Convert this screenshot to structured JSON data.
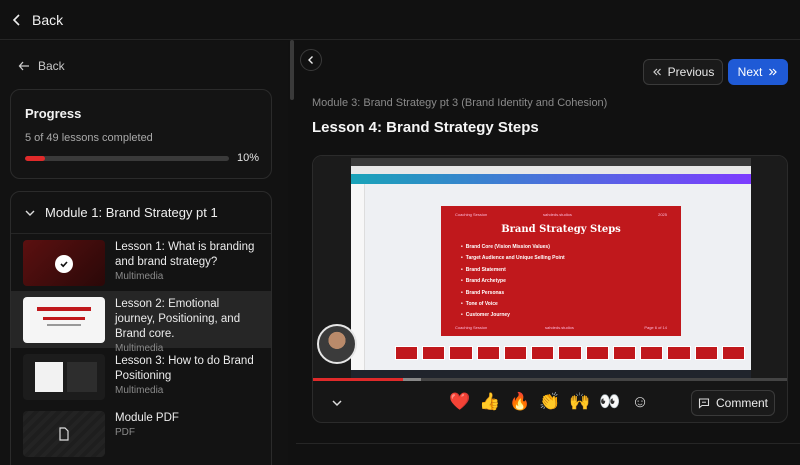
{
  "topbar": {
    "back_label": "Back"
  },
  "sidebar": {
    "back_label": "Back",
    "progress": {
      "title": "Progress",
      "summary": "5 of 49 lessons completed",
      "percent_label": "10%",
      "fraction": 0.1
    },
    "module": {
      "title": "Module 1: Brand Strategy pt 1",
      "lessons": [
        {
          "title": "Lesson 1: What is branding and brand strategy?",
          "type": "Multimedia",
          "completed": true
        },
        {
          "title": "Lesson 2: Emotional journey, Positioning, and Brand core.",
          "type": "Multimedia",
          "active": true
        },
        {
          "title": "Lesson 3: How to do Brand Positioning",
          "type": "Multimedia"
        },
        {
          "title": "Module PDF",
          "type": "PDF"
        }
      ]
    }
  },
  "main": {
    "prev_label": "Previous",
    "next_label": "Next",
    "module_label": "Module 3: Brand Strategy pt 3 (Brand Identity and Cohesion)",
    "lesson_title": "Lesson 4: Brand Strategy Steps",
    "slide": {
      "header_left": "Coaching Session",
      "header_center": "sahdeds.studios",
      "header_right": "2025",
      "title": "Brand Strategy Steps",
      "items": [
        "Brand Core (Vision Mission Values)",
        "Target Audience and Unique Selling Point",
        "Brand Statement",
        "Brand Archetype",
        "Brand Personas",
        "Tone of Voice",
        "Customer Journey"
      ],
      "footer_left": "Coaching Session",
      "footer_center": "sahdeds.studios",
      "footer_right": "Page 6 of 14"
    },
    "video_progress": 0.19,
    "reactions": [
      "❤️",
      "👍",
      "🔥",
      "👏",
      "🙌",
      "👀",
      "☺"
    ],
    "comment_label": "Comment"
  }
}
